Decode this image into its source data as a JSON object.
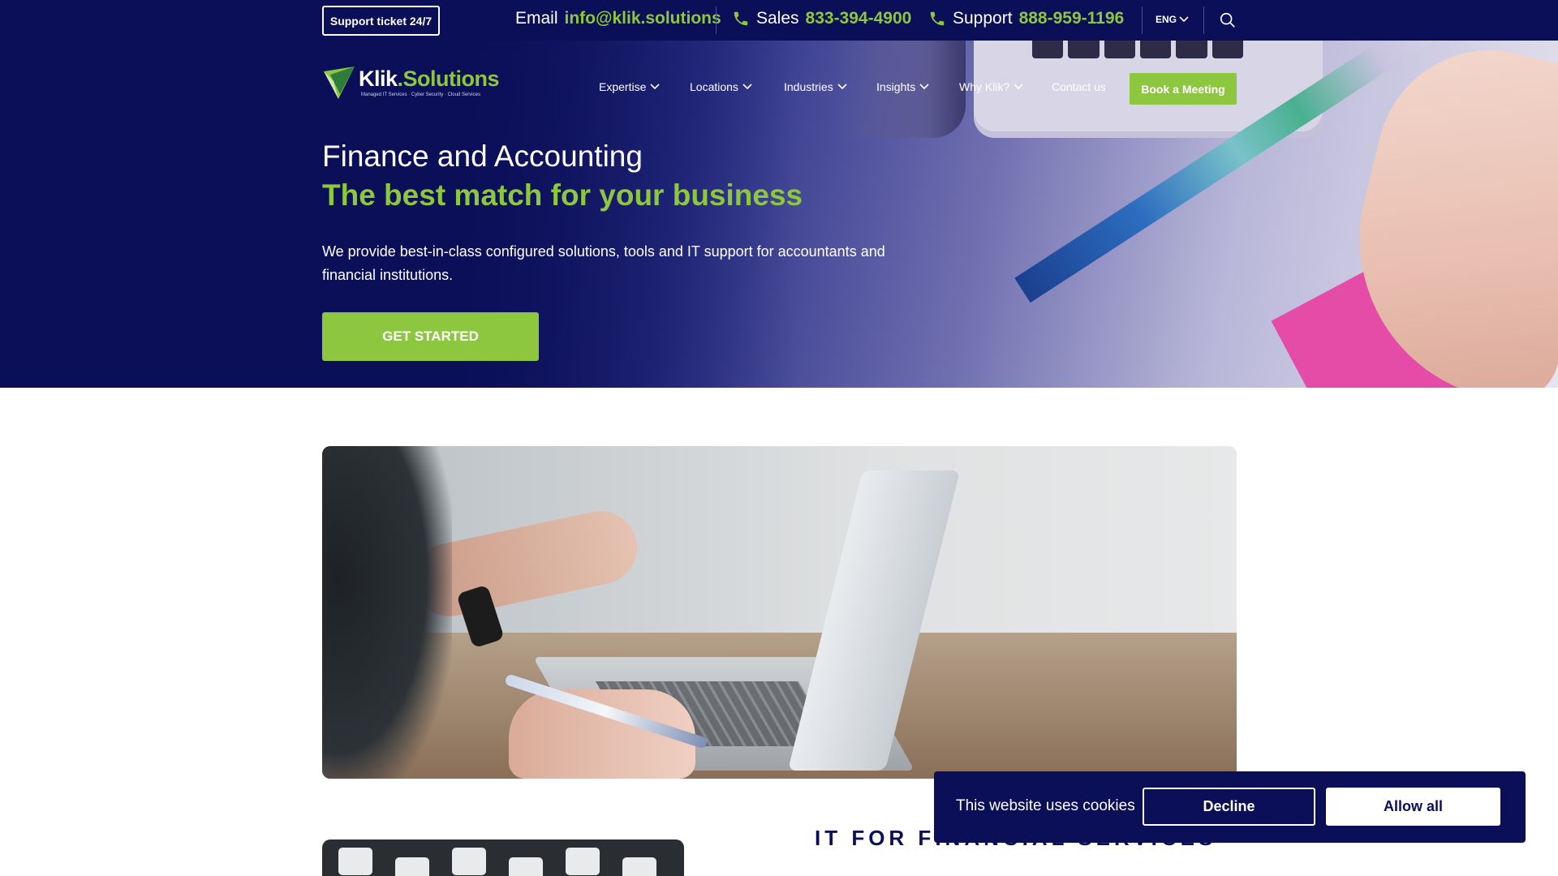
{
  "topbar": {
    "support_ticket_label": "Support ticket 24/7",
    "email_label": "Email",
    "email_value": "info@klik.solutions",
    "sales_label": "Sales",
    "sales_phone": "833-394-4900",
    "support_label": "Support",
    "support_phone": "888-959-1196",
    "language": "ENG",
    "icons": [
      "phone-icon",
      "phone-icon",
      "chevron-down-icon",
      "search-icon"
    ]
  },
  "logo": {
    "brand_primary": "Klik",
    "brand_dot": ".",
    "brand_secondary": "Solutions",
    "tagline": "Managed IT Services · Cyber Security · Cloud Services"
  },
  "nav": {
    "items": [
      {
        "label": "Expertise",
        "has_dropdown": true
      },
      {
        "label": "Locations",
        "has_dropdown": true
      },
      {
        "label": "Industries",
        "has_dropdown": true
      },
      {
        "label": "Insights",
        "has_dropdown": true
      },
      {
        "label": "Why Klik?",
        "has_dropdown": true
      },
      {
        "label": "Contact us",
        "has_dropdown": false
      }
    ],
    "book_meeting_label": "Book a Meeting"
  },
  "hero": {
    "title": "Finance and Accounting",
    "subtitle": "The best match for your business",
    "description": "We provide best-in-class configured solutions, tools and IT support for accountants and financial institutions.",
    "cta_label": "GET STARTED"
  },
  "section": {
    "heading": "IT FOR FINANCIAL SERVICES"
  },
  "cookie_banner": {
    "message": "This website uses cookies",
    "decline_label": "Decline",
    "allow_label": "Allow all"
  },
  "colors": {
    "navy": "#0b0f58",
    "accent_green": "#8dc63f",
    "white": "#ffffff"
  }
}
